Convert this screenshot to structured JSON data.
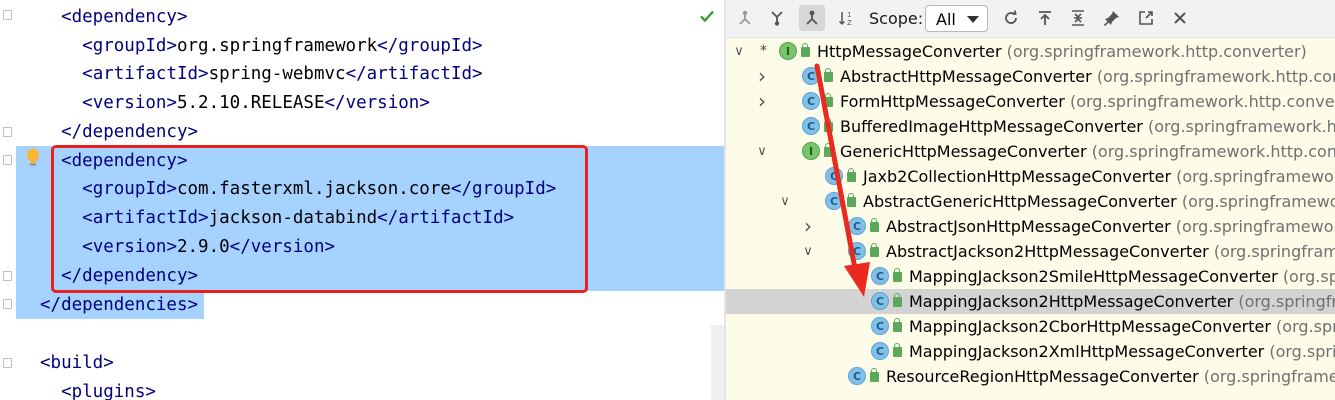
{
  "editor": {
    "lines": [
      {
        "indent": "  ",
        "tag_open": "<dependency>",
        "text": "",
        "tag_close": ""
      },
      {
        "indent": "    ",
        "tag_open": "<groupId>",
        "text": "org.springframework",
        "tag_close": "</groupId>"
      },
      {
        "indent": "    ",
        "tag_open": "<artifactId>",
        "text": "spring-webmvc",
        "tag_close": "</artifactId>"
      },
      {
        "indent": "    ",
        "tag_open": "<version>",
        "text": "5.2.10.RELEASE",
        "tag_close": "</version>"
      },
      {
        "indent": "  ",
        "tag_open": "</dependency>",
        "text": "",
        "tag_close": ""
      },
      {
        "indent": "  ",
        "tag_open": "<dependency>",
        "text": "",
        "tag_close": ""
      },
      {
        "indent": "    ",
        "tag_open": "<groupId>",
        "text": "com.fasterxml.jackson.core",
        "tag_close": "</groupId>"
      },
      {
        "indent": "    ",
        "tag_open": "<artifactId>",
        "text": "jackson-databind",
        "tag_close": "</artifactId>"
      },
      {
        "indent": "    ",
        "tag_open": "<version>",
        "text": "2.9.0",
        "tag_close": "</version>"
      },
      {
        "indent": "  ",
        "tag_open": "</dependency>",
        "text": "",
        "tag_close": ""
      },
      {
        "indent": "",
        "tag_open": "</dependencies>",
        "text": "",
        "tag_close": ""
      },
      {
        "indent": "",
        "tag_open": "",
        "text": "",
        "tag_close": ""
      },
      {
        "indent": "",
        "tag_open": "<build>",
        "text": "",
        "tag_close": ""
      },
      {
        "indent": "  ",
        "tag_open": "<plugins>",
        "text": "",
        "tag_close": ""
      }
    ],
    "highlight_color": "#e8201c",
    "selection_color": "#a6d2ff"
  },
  "hierarchy": {
    "toolbar": {
      "scope_label": "Scope:",
      "scope_value": "All",
      "buttons": [
        "subtypes-icon",
        "supertypes-icon",
        "class-hierarchy-icon",
        "sort-alphabetically-icon",
        "refresh-icon",
        "expand-icon",
        "collapse-all-icon",
        "pin-icon",
        "export-icon",
        "close-icon"
      ]
    },
    "tree": [
      {
        "name": "HttpMessageConverter",
        "pkg": "(org.springframework.http.converter)",
        "kind": "interface",
        "chevron": "down",
        "star": true
      },
      {
        "name": "AbstractHttpMessageConverter",
        "pkg": "(org.springframework.http.converter",
        "kind": "class",
        "chevron": "right"
      },
      {
        "name": "FormHttpMessageConverter",
        "pkg": "(org.springframework.http.converter)",
        "kind": "class",
        "chevron": "right"
      },
      {
        "name": "BufferedImageHttpMessageConverter",
        "pkg": "(org.springframework.http.co",
        "kind": "class",
        "chevron": ""
      },
      {
        "name": "GenericHttpMessageConverter",
        "pkg": "(org.springframework.http.converter",
        "kind": "interface",
        "chevron": "down"
      },
      {
        "name": "Jaxb2CollectionHttpMessageConverter",
        "pkg": "(org.springframework.ht",
        "kind": "class",
        "chevron": ""
      },
      {
        "name": "AbstractGenericHttpMessageConverter",
        "pkg": "(org.springframework.ht",
        "kind": "class",
        "chevron": "down"
      },
      {
        "name": "AbstractJsonHttpMessageConverter",
        "pkg": "(org.springframework.htt",
        "kind": "class",
        "chevron": "right"
      },
      {
        "name": "AbstractJackson2HttpMessageConverter",
        "pkg": "(org.springframewor",
        "kind": "class",
        "chevron": "down"
      },
      {
        "name": "MappingJackson2SmileHttpMessageConverter",
        "pkg": "(org.springf",
        "kind": "class",
        "chevron": ""
      },
      {
        "name": "MappingJackson2HttpMessageConverter",
        "pkg": "(org.springframe",
        "kind": "class",
        "chevron": "",
        "selected": true
      },
      {
        "name": "MappingJackson2CborHttpMessageConverter",
        "pkg": "(org.springfr",
        "kind": "class",
        "chevron": ""
      },
      {
        "name": "MappingJackson2XmlHttpMessageConverter",
        "pkg": "(org.springfra",
        "kind": "class",
        "chevron": ""
      },
      {
        "name": "ResourceRegionHttpMessageConverter",
        "pkg": "(org.springframework",
        "kind": "class",
        "chevron": ""
      }
    ]
  }
}
